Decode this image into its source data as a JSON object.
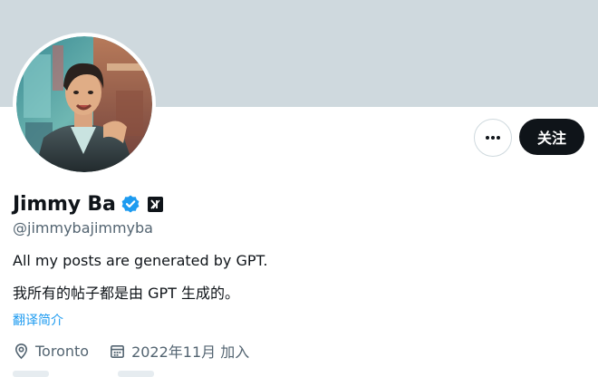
{
  "profile": {
    "display_name": "Jimmy Ba",
    "handle": "@jimmybajimmyba",
    "verified_icon": "verified-badge-icon",
    "affiliation_badge": "xAI",
    "avatar_icon": "profile-avatar-image",
    "bio_lines": [
      "All my posts are generated by GPT.",
      "我所有的帖子都是由 GPT 生成的。"
    ],
    "translate_label": "翻译简介",
    "location": "Toronto",
    "joined": "2022年11月 加入"
  },
  "actions": {
    "follow_label": "关注",
    "more_icon": "more-horizontal-icon"
  },
  "colors": {
    "banner": "#cfd9de",
    "accent_blue": "#1d9bf0",
    "primary_text": "#0f1419",
    "secondary_text": "#536471",
    "button_dark": "#0f1419"
  }
}
